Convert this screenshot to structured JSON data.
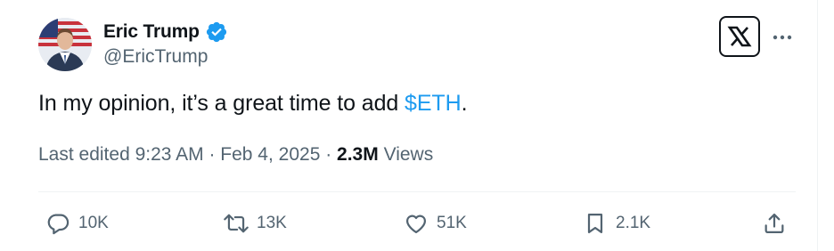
{
  "author": {
    "display_name": "Eric Trump",
    "handle": "@EricTrump",
    "verified": true
  },
  "tweet": {
    "text_before": "In my opinion, it’s a great time to add ",
    "cashtag": "$ETH",
    "text_after": "."
  },
  "meta": {
    "edited_label": "Last edited 9:23 AM · Feb 4, 2025 · ",
    "views_count": "2.3M",
    "views_label": " Views"
  },
  "actions": {
    "replies": "10K",
    "reposts": "13K",
    "likes": "51K",
    "bookmarks": "2.1K"
  },
  "icons": {
    "verified": "verified-badge-icon",
    "x_logo": "x-logo-icon",
    "more": "more-dots-icon",
    "reply": "reply-icon",
    "repost": "repost-icon",
    "like": "heart-icon",
    "bookmark": "bookmark-icon",
    "share": "share-icon"
  },
  "colors": {
    "text": "#0f1419",
    "secondary": "#536471",
    "link": "#1d9bf0",
    "divider": "#eff3f4"
  }
}
